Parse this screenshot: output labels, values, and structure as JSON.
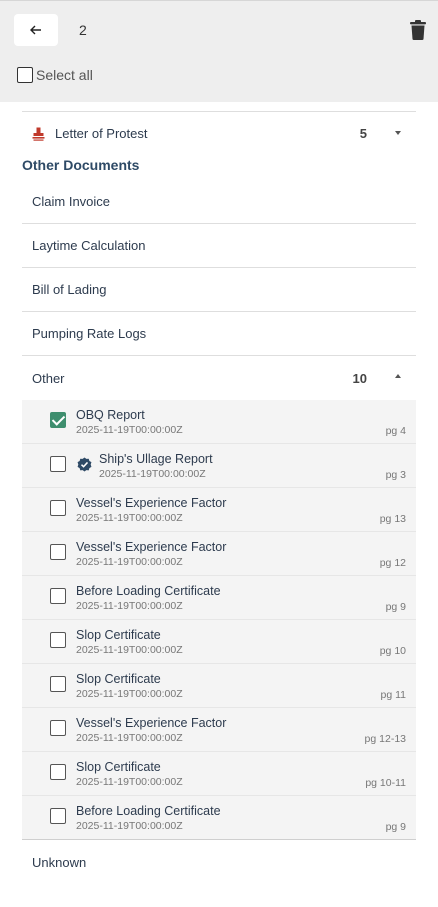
{
  "header": {
    "selected_count": "2",
    "select_all_label": "Select all"
  },
  "groups": [
    {
      "label": "Letter of Protest",
      "count": "5",
      "expanded": false,
      "icon": "stamp-icon"
    }
  ],
  "section_title": "Other Documents",
  "folders": [
    {
      "label": "Claim Invoice"
    },
    {
      "label": "Laytime Calculation"
    },
    {
      "label": "Bill of Lading"
    },
    {
      "label": "Pumping Rate Logs"
    }
  ],
  "other_folder": {
    "label": "Other",
    "count": "10",
    "expanded": true
  },
  "documents": [
    {
      "title": "OBQ Report",
      "date": "2025-11-19T00:00:00Z",
      "page": "pg 4",
      "checked": true,
      "verified": false
    },
    {
      "title": "Ship's Ullage Report",
      "date": "2025-11-19T00:00:00Z",
      "page": "pg 3",
      "checked": false,
      "verified": true
    },
    {
      "title": "Vessel's Experience Factor",
      "date": "2025-11-19T00:00:00Z",
      "page": "pg 13",
      "checked": false,
      "verified": false
    },
    {
      "title": "Vessel's Experience Factor",
      "date": "2025-11-19T00:00:00Z",
      "page": "pg 12",
      "checked": false,
      "verified": false
    },
    {
      "title": "Before Loading Certificate",
      "date": "2025-11-19T00:00:00Z",
      "page": "pg 9",
      "checked": false,
      "verified": false
    },
    {
      "title": "Slop Certificate",
      "date": "2025-11-19T00:00:00Z",
      "page": "pg 10",
      "checked": false,
      "verified": false
    },
    {
      "title": "Slop Certificate",
      "date": "2025-11-19T00:00:00Z",
      "page": "pg 11",
      "checked": false,
      "verified": false
    },
    {
      "title": "Vessel's Experience Factor",
      "date": "2025-11-19T00:00:00Z",
      "page": "pg 12-13",
      "checked": false,
      "verified": false
    },
    {
      "title": "Slop Certificate",
      "date": "2025-11-19T00:00:00Z",
      "page": "pg 10-11",
      "checked": false,
      "verified": false
    },
    {
      "title": "Before Loading Certificate",
      "date": "2025-11-19T00:00:00Z",
      "page": "pg 9",
      "checked": false,
      "verified": false
    }
  ],
  "unknown_folder": {
    "label": "Unknown"
  },
  "colors": {
    "checked": "#3e8e6e",
    "verified_badge": "#2e4a66",
    "stamp": "#c0392b"
  }
}
